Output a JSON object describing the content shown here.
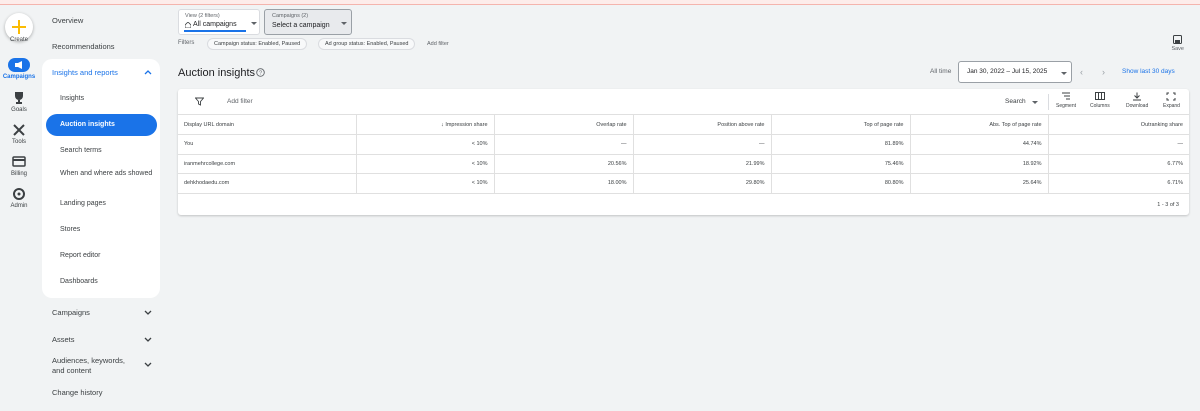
{
  "rail": {
    "create": "Create",
    "campaigns": "Campaigns",
    "goals": "Goals",
    "tools": "Tools",
    "billing": "Billing",
    "admin": "Admin"
  },
  "nav": {
    "overview": "Overview",
    "recommendations": "Recommendations",
    "insights_reports": "Insights and reports",
    "sub": {
      "insights": "Insights",
      "auction_insights": "Auction insights",
      "search_terms": "Search terms",
      "when_where": "When and where ads showed",
      "landing_pages": "Landing pages",
      "stores": "Stores",
      "report_editor": "Report editor",
      "dashboards": "Dashboards"
    },
    "campaigns": "Campaigns",
    "assets": "Assets",
    "audiences": "Audiences, keywords, and content",
    "change_history": "Change history"
  },
  "header": {
    "view_small": "View (2 filters)",
    "view_value": "All campaigns",
    "campaigns_small": "Campaigns (2)",
    "campaigns_value": "Select a campaign",
    "filters_label": "Filters",
    "chips": [
      "Campaign status: Enabled, Paused",
      "Ad group status: Enabled, Paused"
    ],
    "add_filter": "Add filter",
    "save": "Save"
  },
  "page": {
    "title": "Auction insights",
    "all_time": "All time",
    "date_range": "Jan 30, 2022 – Jul 15, 2025",
    "show_last": "Show last 30 days"
  },
  "toolbar": {
    "add_filter": "Add filter",
    "search": "Search",
    "segment": "Segment",
    "columns": "Columns",
    "download": "Download",
    "expand": "Expand"
  },
  "table": {
    "headers": [
      "Display URL domain",
      "Impression share",
      "Overlap rate",
      "Position above rate",
      "Top of page rate",
      "Abs. Top of page rate",
      "Outranking share"
    ],
    "rows": [
      [
        "You",
        "< 10%",
        "—",
        "—",
        "81.89%",
        "44.74%",
        "—"
      ],
      [
        "iranmehrcollege.com",
        "< 10%",
        "20.56%",
        "21.99%",
        "75.46%",
        "18.92%",
        "6.77%"
      ],
      [
        "dehkhodaedu.com",
        "< 10%",
        "18.00%",
        "29.80%",
        "80.80%",
        "25.64%",
        "6.71%"
      ]
    ],
    "pager": "1 - 3 of 3"
  }
}
